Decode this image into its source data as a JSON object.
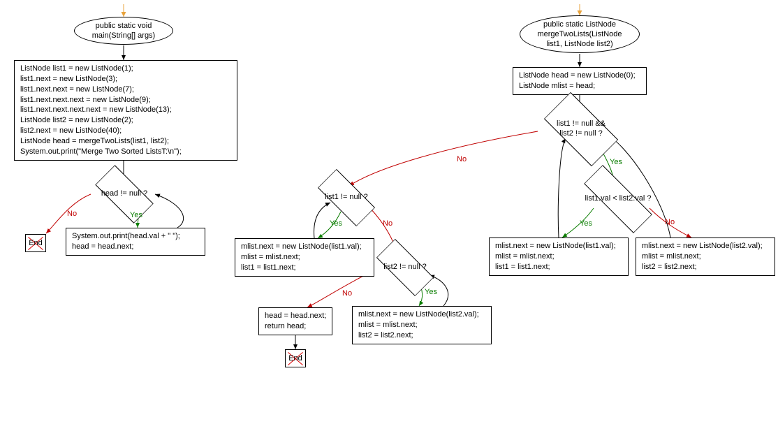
{
  "chart_data": {
    "type": "flowchart",
    "flowcharts": [
      {
        "name": "main",
        "start": "n1",
        "nodes": {
          "n1": {
            "type": "ellipse",
            "text": "public static void\nmain(String[] args)"
          },
          "n2": {
            "type": "rect",
            "text": "ListNode list1 = new ListNode(1);\nlist1.next = new ListNode(3);\nlist1.next.next = new ListNode(7);\nlist1.next.next.next = new ListNode(9);\nlist1.next.next.next.next = new ListNode(13);\nListNode list2 = new ListNode(2);\nlist2.next = new ListNode(40);\nListNode head = mergeTwoLists(list1, list2);\nSystem.out.print(\"Merge Two Sorted ListsT:\\n\");"
          },
          "n3": {
            "type": "decision",
            "text": "head != null ?"
          },
          "n4": {
            "type": "rect",
            "text": "System.out.print(head.val + \" \");\nhead = head.next;"
          },
          "n5": {
            "type": "end",
            "text": "End"
          }
        },
        "edges": [
          {
            "from": "n1",
            "to": "n2"
          },
          {
            "from": "n2",
            "to": "n3"
          },
          {
            "from": "n3",
            "to": "n4",
            "label": "Yes"
          },
          {
            "from": "n3",
            "to": "n5",
            "label": "No"
          },
          {
            "from": "n4",
            "to": "n3"
          }
        ]
      },
      {
        "name": "mergeTwoLists",
        "start": "m1",
        "nodes": {
          "m1": {
            "type": "ellipse",
            "text": "public static ListNode\nmergeTwoLists(ListNode\nlist1, ListNode list2)"
          },
          "m2": {
            "type": "rect",
            "text": "ListNode head = new ListNode(0);\nListNode mlist = head;"
          },
          "m3": {
            "type": "decision",
            "text": "list1 != null &&\nlist2 != null ?"
          },
          "m4": {
            "type": "decision",
            "text": "list1.val < list2.val ?"
          },
          "m5": {
            "type": "rect",
            "text": "mlist.next = new ListNode(list1.val);\nmlist = mlist.next;\nlist1 = list1.next;"
          },
          "m6": {
            "type": "rect",
            "text": "mlist.next = new ListNode(list2.val);\nmlist = mlist.next;\nlist2 = list2.next;"
          },
          "m7": {
            "type": "decision",
            "text": "list1 != null ?"
          },
          "m8": {
            "type": "rect",
            "text": "mlist.next = new ListNode(list1.val);\nmlist = mlist.next;\nlist1 = list1.next;"
          },
          "m9": {
            "type": "decision",
            "text": "list2 != null ?"
          },
          "m10": {
            "type": "rect",
            "text": "mlist.next = new ListNode(list2.val);\nmlist = mlist.next;\nlist2 = list2.next;"
          },
          "m11": {
            "type": "rect",
            "text": "head = head.next;\nreturn head;"
          },
          "m12": {
            "type": "end",
            "text": "End"
          }
        },
        "edges": [
          {
            "from": "m1",
            "to": "m2"
          },
          {
            "from": "m2",
            "to": "m3"
          },
          {
            "from": "m3",
            "to": "m4",
            "label": "Yes"
          },
          {
            "from": "m3",
            "to": "m7",
            "label": "No"
          },
          {
            "from": "m4",
            "to": "m5",
            "label": "Yes"
          },
          {
            "from": "m4",
            "to": "m6",
            "label": "No"
          },
          {
            "from": "m5",
            "to": "m3"
          },
          {
            "from": "m6",
            "to": "m3"
          },
          {
            "from": "m7",
            "to": "m8",
            "label": "Yes"
          },
          {
            "from": "m7",
            "to": "m9",
            "label": "No"
          },
          {
            "from": "m8",
            "to": "m7"
          },
          {
            "from": "m9",
            "to": "m10",
            "label": "Yes"
          },
          {
            "from": "m9",
            "to": "m11",
            "label": "No"
          },
          {
            "from": "m10",
            "to": "m9"
          },
          {
            "from": "m11",
            "to": "m12"
          }
        ]
      }
    ]
  },
  "labels": {
    "yes": "Yes",
    "no": "No"
  },
  "nodes": {
    "n1": "public static void\nmain(String[] args)",
    "n2": "ListNode list1 = new ListNode(1);\nlist1.next = new ListNode(3);\nlist1.next.next = new ListNode(7);\nlist1.next.next.next = new ListNode(9);\nlist1.next.next.next.next = new ListNode(13);\nListNode list2 = new ListNode(2);\nlist2.next = new ListNode(40);\nListNode head = mergeTwoLists(list1, list2);\nSystem.out.print(\"Merge Two Sorted ListsT:\\n\");",
    "n3": "head != null ?",
    "n4": "System.out.print(head.val + \" \");\nhead = head.next;",
    "n5": "End",
    "m1": "public static ListNode\nmergeTwoLists(ListNode\nlist1, ListNode list2)",
    "m2": "ListNode head = new ListNode(0);\nListNode mlist = head;",
    "m3": "list1 != null &&\nlist2 != null ?",
    "m4": "list1.val < list2.val ?",
    "m5": "mlist.next = new ListNode(list1.val);\nmlist = mlist.next;\nlist1 = list1.next;",
    "m6": "mlist.next = new ListNode(list2.val);\nmlist = mlist.next;\nlist2 = list2.next;",
    "m7": "list1 != null ?",
    "m8": "mlist.next = new ListNode(list1.val);\nmlist = mlist.next;\nlist1 = list1.next;",
    "m9": "list2 != null ?",
    "m10": "mlist.next = new ListNode(list2.val);\nmlist = mlist.next;\nlist2 = list2.next;",
    "m11": "head = head.next;\nreturn head;",
    "m12": "End"
  }
}
